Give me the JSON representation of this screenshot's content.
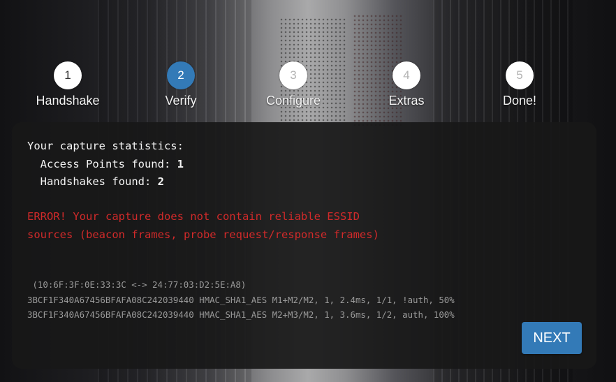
{
  "steps": [
    {
      "number": "1",
      "label": "Handshake",
      "state": "done"
    },
    {
      "number": "2",
      "label": "Verify",
      "state": "active"
    },
    {
      "number": "3",
      "label": "Configure",
      "state": "future"
    },
    {
      "number": "4",
      "label": "Extras",
      "state": "future"
    },
    {
      "number": "5",
      "label": "Done!",
      "state": "future"
    }
  ],
  "stats": {
    "heading": "Your capture statistics:",
    "ap_label": "Access Points found:",
    "ap_count": "1",
    "hs_label": "Handshakes found:",
    "hs_count": "2"
  },
  "error": {
    "line1": "ERROR! Your capture does not contain reliable ESSID",
    "line2": "sources (beacon frames, probe request/response frames)"
  },
  "details": {
    "pair": " (10:6F:3F:0E:33:3C <-> 24:77:03:D2:5E:A8)",
    "rows": [
      "3BCF1F340A67456BFAFA08C242039440 HMAC_SHA1_AES M1+M2/M2, 1, 2.4ms, 1/1, !auth, 50%",
      "3BCF1F340A67456BFAFA08C242039440 HMAC_SHA1_AES M2+M3/M2, 1, 3.6ms, 1/2, auth, 100%"
    ]
  },
  "buttons": {
    "next": "NEXT"
  },
  "colors": {
    "accent": "#337ab7",
    "error": "#d12a2a",
    "panel": "#181818"
  }
}
